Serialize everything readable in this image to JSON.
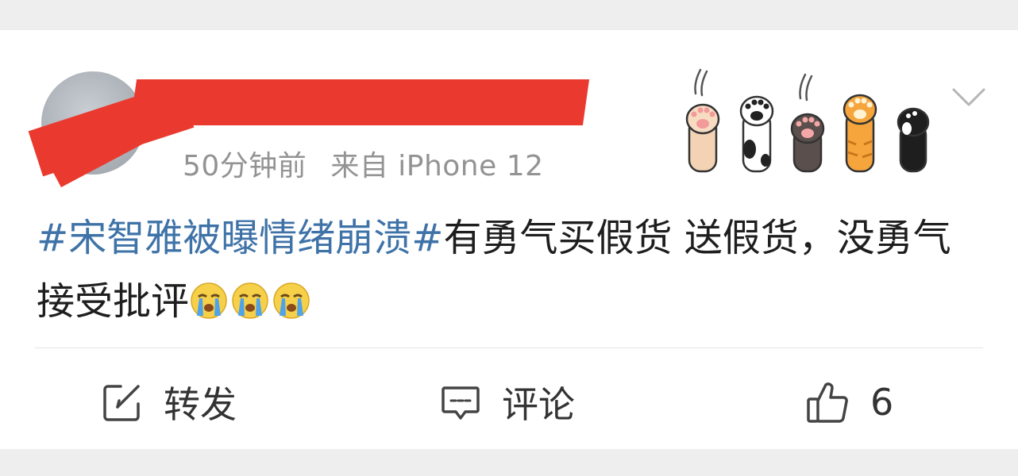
{
  "post": {
    "time": "50分钟前",
    "source": "来自 iPhone 12",
    "topic": "#宋智雅被曝情绪崩溃#",
    "text": "有勇气买假货 送假货，没勇气接受批评",
    "emojis": [
      "loudly-crying-face",
      "loudly-crying-face",
      "loudly-crying-face"
    ]
  },
  "actions": {
    "repost_label": "转发",
    "comment_label": "评论",
    "like_count": "6"
  },
  "colors": {
    "topic": "#3f73a8",
    "meta": "#939393",
    "redaction": "#ea3a2f"
  }
}
